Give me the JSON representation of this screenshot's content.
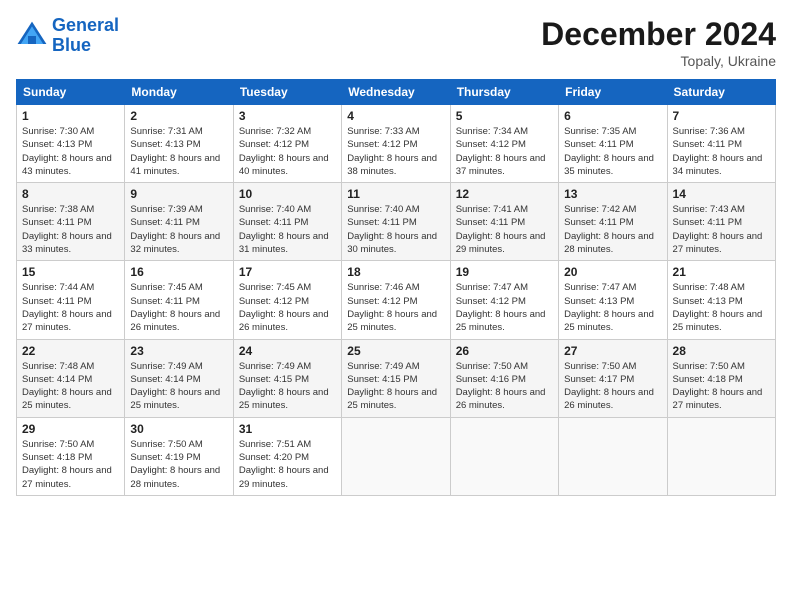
{
  "header": {
    "logo_line1": "General",
    "logo_line2": "Blue",
    "title": "December 2024",
    "subtitle": "Topaly, Ukraine"
  },
  "days_of_week": [
    "Sunday",
    "Monday",
    "Tuesday",
    "Wednesday",
    "Thursday",
    "Friday",
    "Saturday"
  ],
  "weeks": [
    [
      {
        "day": "1",
        "sunrise": "7:30 AM",
        "sunset": "4:13 PM",
        "daylight": "8 hours and 43 minutes."
      },
      {
        "day": "2",
        "sunrise": "7:31 AM",
        "sunset": "4:13 PM",
        "daylight": "8 hours and 41 minutes."
      },
      {
        "day": "3",
        "sunrise": "7:32 AM",
        "sunset": "4:12 PM",
        "daylight": "8 hours and 40 minutes."
      },
      {
        "day": "4",
        "sunrise": "7:33 AM",
        "sunset": "4:12 PM",
        "daylight": "8 hours and 38 minutes."
      },
      {
        "day": "5",
        "sunrise": "7:34 AM",
        "sunset": "4:12 PM",
        "daylight": "8 hours and 37 minutes."
      },
      {
        "day": "6",
        "sunrise": "7:35 AM",
        "sunset": "4:11 PM",
        "daylight": "8 hours and 35 minutes."
      },
      {
        "day": "7",
        "sunrise": "7:36 AM",
        "sunset": "4:11 PM",
        "daylight": "8 hours and 34 minutes."
      }
    ],
    [
      {
        "day": "8",
        "sunrise": "7:38 AM",
        "sunset": "4:11 PM",
        "daylight": "8 hours and 33 minutes."
      },
      {
        "day": "9",
        "sunrise": "7:39 AM",
        "sunset": "4:11 PM",
        "daylight": "8 hours and 32 minutes."
      },
      {
        "day": "10",
        "sunrise": "7:40 AM",
        "sunset": "4:11 PM",
        "daylight": "8 hours and 31 minutes."
      },
      {
        "day": "11",
        "sunrise": "7:40 AM",
        "sunset": "4:11 PM",
        "daylight": "8 hours and 30 minutes."
      },
      {
        "day": "12",
        "sunrise": "7:41 AM",
        "sunset": "4:11 PM",
        "daylight": "8 hours and 29 minutes."
      },
      {
        "day": "13",
        "sunrise": "7:42 AM",
        "sunset": "4:11 PM",
        "daylight": "8 hours and 28 minutes."
      },
      {
        "day": "14",
        "sunrise": "7:43 AM",
        "sunset": "4:11 PM",
        "daylight": "8 hours and 27 minutes."
      }
    ],
    [
      {
        "day": "15",
        "sunrise": "7:44 AM",
        "sunset": "4:11 PM",
        "daylight": "8 hours and 27 minutes."
      },
      {
        "day": "16",
        "sunrise": "7:45 AM",
        "sunset": "4:11 PM",
        "daylight": "8 hours and 26 minutes."
      },
      {
        "day": "17",
        "sunrise": "7:45 AM",
        "sunset": "4:12 PM",
        "daylight": "8 hours and 26 minutes."
      },
      {
        "day": "18",
        "sunrise": "7:46 AM",
        "sunset": "4:12 PM",
        "daylight": "8 hours and 25 minutes."
      },
      {
        "day": "19",
        "sunrise": "7:47 AM",
        "sunset": "4:12 PM",
        "daylight": "8 hours and 25 minutes."
      },
      {
        "day": "20",
        "sunrise": "7:47 AM",
        "sunset": "4:13 PM",
        "daylight": "8 hours and 25 minutes."
      },
      {
        "day": "21",
        "sunrise": "7:48 AM",
        "sunset": "4:13 PM",
        "daylight": "8 hours and 25 minutes."
      }
    ],
    [
      {
        "day": "22",
        "sunrise": "7:48 AM",
        "sunset": "4:14 PM",
        "daylight": "8 hours and 25 minutes."
      },
      {
        "day": "23",
        "sunrise": "7:49 AM",
        "sunset": "4:14 PM",
        "daylight": "8 hours and 25 minutes."
      },
      {
        "day": "24",
        "sunrise": "7:49 AM",
        "sunset": "4:15 PM",
        "daylight": "8 hours and 25 minutes."
      },
      {
        "day": "25",
        "sunrise": "7:49 AM",
        "sunset": "4:15 PM",
        "daylight": "8 hours and 25 minutes."
      },
      {
        "day": "26",
        "sunrise": "7:50 AM",
        "sunset": "4:16 PM",
        "daylight": "8 hours and 26 minutes."
      },
      {
        "day": "27",
        "sunrise": "7:50 AM",
        "sunset": "4:17 PM",
        "daylight": "8 hours and 26 minutes."
      },
      {
        "day": "28",
        "sunrise": "7:50 AM",
        "sunset": "4:18 PM",
        "daylight": "8 hours and 27 minutes."
      }
    ],
    [
      {
        "day": "29",
        "sunrise": "7:50 AM",
        "sunset": "4:18 PM",
        "daylight": "8 hours and 27 minutes."
      },
      {
        "day": "30",
        "sunrise": "7:50 AM",
        "sunset": "4:19 PM",
        "daylight": "8 hours and 28 minutes."
      },
      {
        "day": "31",
        "sunrise": "7:51 AM",
        "sunset": "4:20 PM",
        "daylight": "8 hours and 29 minutes."
      },
      null,
      null,
      null,
      null
    ]
  ]
}
